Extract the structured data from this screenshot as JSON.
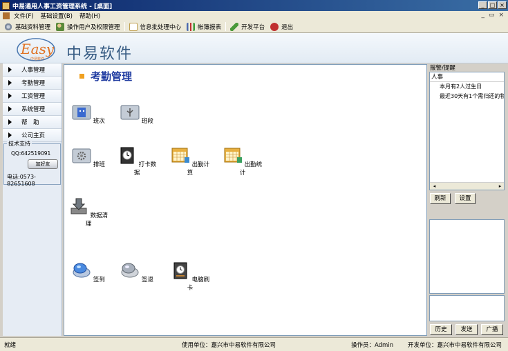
{
  "window": {
    "title": "中易通用人事工资管理系统 - [桌面]",
    "min_label": "_",
    "max_label": "□",
    "close_label": "×"
  },
  "menu": {
    "items": [
      "文件(F)",
      "基础设置(B)",
      "帮助(H)"
    ],
    "mdi_controls": [
      "_",
      "▭",
      "×"
    ]
  },
  "toolbar": {
    "items": [
      {
        "label": "基础资料管理",
        "icon": "gear-icon",
        "color": "#7d8a9c"
      },
      {
        "label": "操作用户及权限管理",
        "icon": "users-icon",
        "color": "#5a8a3a"
      },
      {
        "label": "信息批处理中心",
        "icon": "document-icon",
        "color": "#c0a050"
      },
      {
        "label": "帐簿报表",
        "icon": "bar-chart-icon",
        "color": "#4a6ab0"
      },
      {
        "label": "开发平台",
        "icon": "pen-icon",
        "color": "#4a9a3a"
      },
      {
        "label": "退出",
        "icon": "exit-icon",
        "color": "#c03030"
      }
    ]
  },
  "header": {
    "logo_word": "Easy",
    "logo_sub": "中易软件",
    "brand": "中易软件"
  },
  "nav": {
    "items": [
      "人事管理",
      "考勤管理",
      "工资管理",
      "系统管理",
      "帮　助",
      "公司主页"
    ]
  },
  "support": {
    "title": "技术支持",
    "qq": "QQ:642519091",
    "qq_button": "加好友",
    "tel": "电话:0573-82651608"
  },
  "main": {
    "title": "考勤管理",
    "icons": [
      {
        "label": "班次",
        "icon": "mac-finder-icon"
      },
      {
        "label": "班段",
        "icon": "usb-icon"
      },
      {
        "label": "排班",
        "icon": "gear-folder-icon"
      },
      {
        "label": "打卡数据",
        "icon": "clock-icon"
      },
      {
        "label": "出勤计算",
        "icon": "calendar-icon"
      },
      {
        "label": "出勤统计",
        "icon": "calendar-stats-icon"
      },
      {
        "label": "数据清理",
        "icon": "download-tray-icon"
      },
      {
        "label": "签到",
        "icon": "sign-in-icon"
      },
      {
        "label": "签退",
        "icon": "sign-out-icon"
      },
      {
        "label": "电脑刷卡",
        "icon": "clock-card-icon"
      }
    ]
  },
  "alerts": {
    "title": "报警/提醒",
    "category": "人事",
    "rows": [
      "本月有2人过生日",
      "最近30天有1个需归还的物"
    ],
    "refresh_label": "刷新",
    "settings_label": "设置",
    "history_label": "历史",
    "send_label": "发送",
    "broadcast_label": "广播"
  },
  "status": {
    "state": "就绪",
    "user_unit": "使用单位：嘉兴市中易软件有限公司",
    "operator": "操作员：Admin",
    "dev_unit": "开发单位：嘉兴市中易软件有限公司"
  },
  "colors": {
    "title_bar": "#0a246a",
    "main_title": "#1e3aa0",
    "accent": "#f0a020"
  }
}
